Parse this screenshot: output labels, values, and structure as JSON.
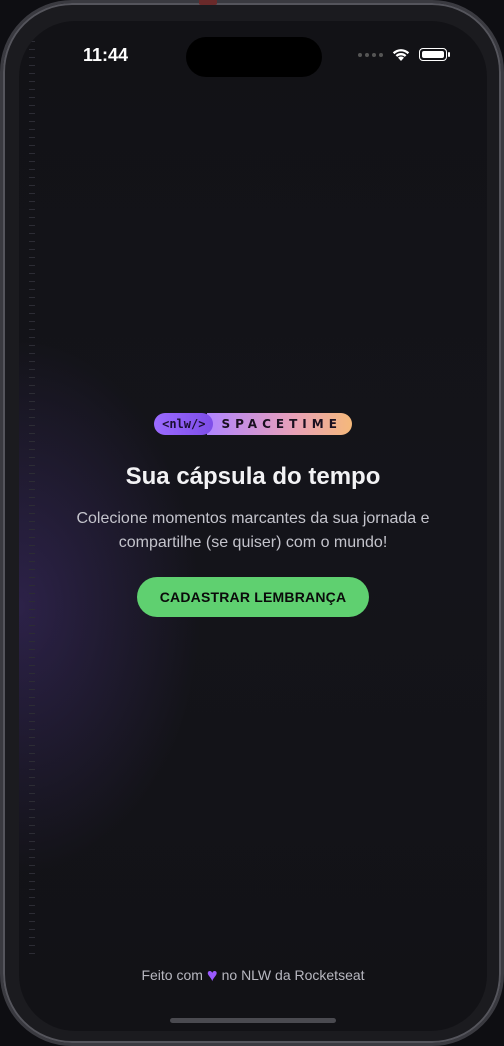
{
  "status_bar": {
    "time": "11:44",
    "icons": [
      "cellular-signal-icon",
      "wifi-icon",
      "battery-icon"
    ]
  },
  "logo": {
    "nlw": "<nlw/>",
    "brand": "SPACETIME"
  },
  "hero": {
    "title": "Sua cápsula do tempo",
    "subtitle": "Colecione momentos marcantes da sua jornada e compartilhe (se quiser) com o mundo!",
    "cta_label": "CADASTRAR LEMBRANÇA"
  },
  "footer": {
    "before": "Feito com",
    "after": "no NLW da Rocketseat",
    "heart_icon": "purple-heart-icon"
  },
  "colors": {
    "accent_green": "#5fd070",
    "accent_purple": "#9b6bff",
    "background": "#121216"
  }
}
